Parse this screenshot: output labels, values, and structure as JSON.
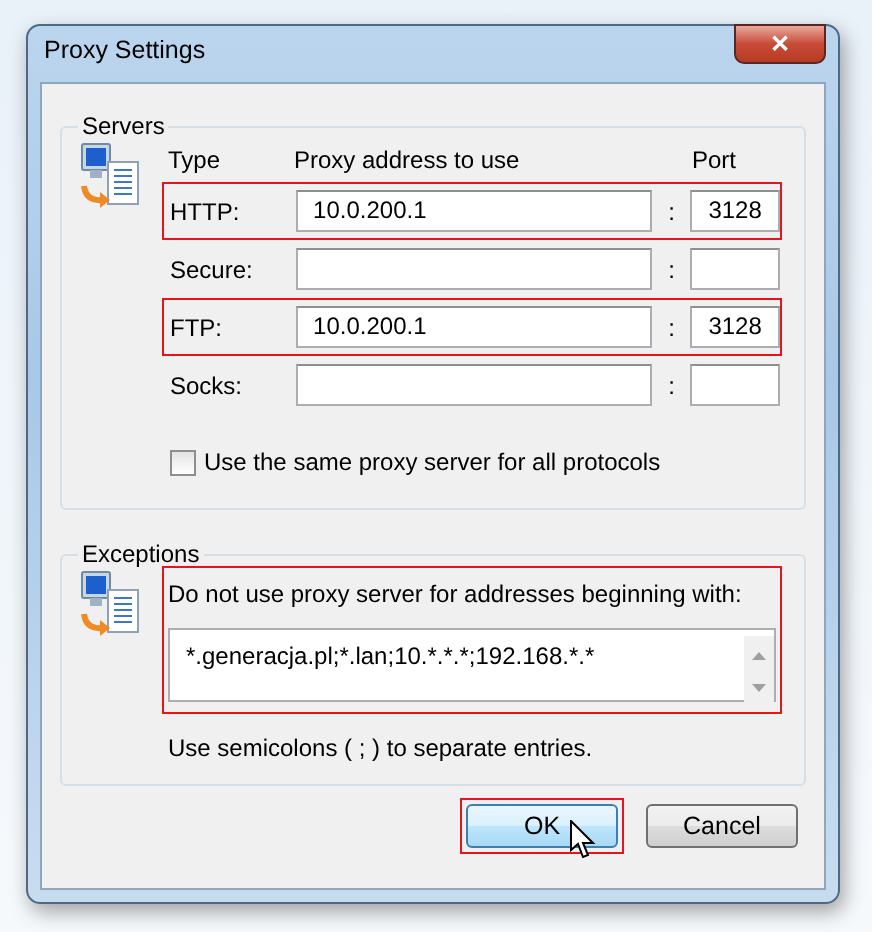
{
  "window": {
    "title": "Proxy Settings",
    "close_label": "✕"
  },
  "servers": {
    "legend": "Servers",
    "columns": [
      "Type",
      "Proxy address to use",
      "Port"
    ],
    "rows": [
      {
        "label": "HTTP:",
        "address": "10.0.200.1",
        "port": "3128",
        "highlighted": true
      },
      {
        "label": "Secure:",
        "address": "",
        "port": "",
        "highlighted": false
      },
      {
        "label": "FTP:",
        "address": "10.0.200.1",
        "port": "3128",
        "highlighted": true
      },
      {
        "label": "Socks:",
        "address": "",
        "port": "",
        "highlighted": false
      }
    ],
    "separator": ":",
    "same_proxy": {
      "label": "Use the same proxy server for all protocols",
      "checked": false
    }
  },
  "exceptions": {
    "legend": "Exceptions",
    "label": "Do not use proxy server for addresses beginning with:",
    "value": "*.generacja.pl;*.lan;10.*.*.*;192.168.*.*",
    "highlighted": true,
    "hint": "Use semicolons ( ; ) to separate entries."
  },
  "buttons": [
    {
      "label": "OK",
      "default": true,
      "highlighted": true,
      "pointer": true
    },
    {
      "label": "Cancel",
      "default": false,
      "highlighted": false,
      "pointer": false
    }
  ]
}
